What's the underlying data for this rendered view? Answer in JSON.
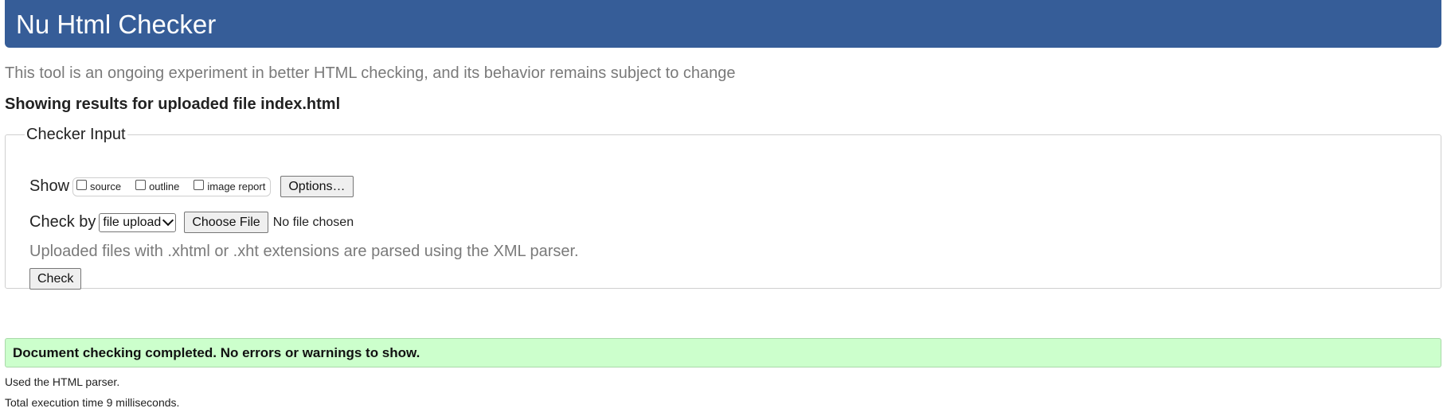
{
  "header": {
    "title": "Nu Html Checker",
    "background_color": "#365d98"
  },
  "tagline": "This tool is an ongoing experiment in better HTML checking, and its behavior remains subject to change",
  "results_heading": "Showing results for uploaded file index.html",
  "checker_input": {
    "legend": "Checker Input",
    "show": {
      "label": "Show",
      "options": [
        {
          "label": "source",
          "checked": false
        },
        {
          "label": "outline",
          "checked": false
        },
        {
          "label": "image report",
          "checked": false
        }
      ],
      "options_button_label": "Options…"
    },
    "check_by": {
      "label": "Check by",
      "selected": "file upload",
      "choose_file_label": "Choose File",
      "file_status": "No file chosen"
    },
    "hint": "Uploaded files with .xhtml or .xht extensions are parsed using the XML parser.",
    "check_button_label": "Check"
  },
  "status": {
    "message": "Document checking completed. No errors or warnings to show.",
    "background_color": "#ccffcc"
  },
  "footnotes": {
    "parser": "Used the HTML parser.",
    "execution_time": "Total execution time 9 milliseconds."
  }
}
